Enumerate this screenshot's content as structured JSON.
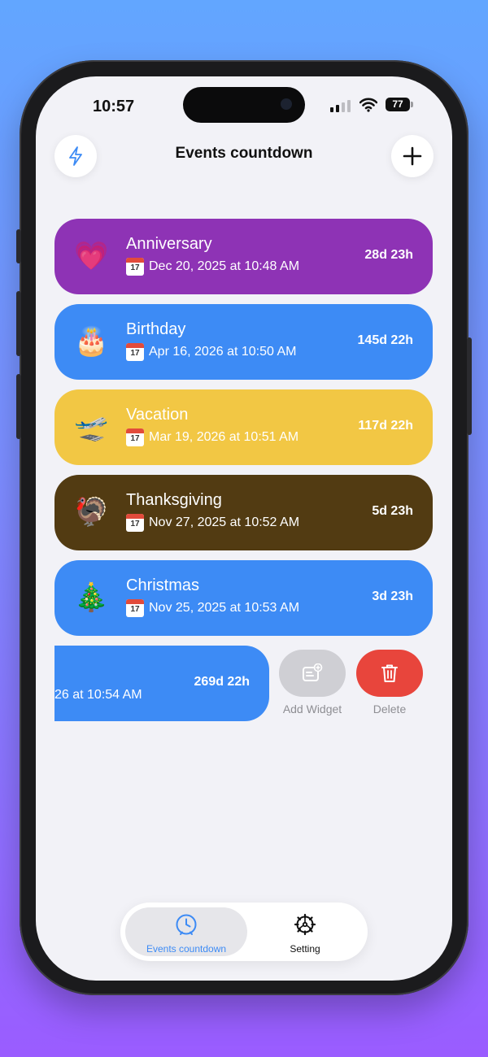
{
  "status_bar": {
    "time": "10:57",
    "battery": "77"
  },
  "header": {
    "title": "Events countdown",
    "left_icon": "lightning-icon",
    "right_icon": "plus-icon"
  },
  "events": [
    {
      "name": "Anniversary",
      "emoji": "💗",
      "date": "Dec 20, 2025 at 10:48 AM",
      "countdown": "28d 23h",
      "color": "#8e33b5"
    },
    {
      "name": "Birthday",
      "emoji": "🎂",
      "date": "Apr 16, 2026 at 10:50 AM",
      "countdown": "145d 22h",
      "color": "#3d8bf5"
    },
    {
      "name": "Vacation",
      "emoji": "🛫",
      "date": "Mar 19, 2026 at 10:51 AM",
      "countdown": "117d 22h",
      "color": "#f2c744"
    },
    {
      "name": "Thanksgiving",
      "emoji": "🦃",
      "date": "Nov 27, 2025 at 10:52 AM",
      "countdown": "5d 23h",
      "color": "#523b12"
    },
    {
      "name": "Christmas",
      "emoji": "🎄",
      "date": "Nov 25, 2025 at 10:53 AM",
      "countdown": "3d 23h",
      "color": "#3d8bf5"
    }
  ],
  "calendar_day": "17",
  "swiped_event": {
    "date_partial": "26 at 10:54 AM",
    "countdown": "269d 22h",
    "color": "#3d8bf5"
  },
  "swipe_actions": {
    "add_widget": "Add Widget",
    "delete": "Delete"
  },
  "tabs": [
    {
      "label": "Events countdown",
      "icon": "clock-icon",
      "active": true
    },
    {
      "label": "Setting",
      "icon": "gear-icon",
      "active": false
    }
  ],
  "colors": {
    "accent": "#3d8bf5",
    "delete": "#e8453c",
    "widget_gray": "#cfcfd4"
  }
}
